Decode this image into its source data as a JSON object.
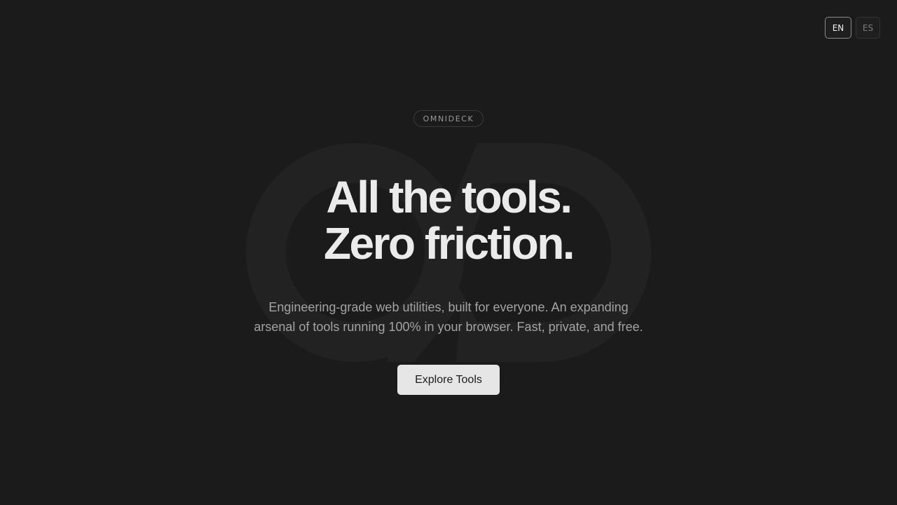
{
  "language_switch": {
    "options": [
      {
        "label": "EN",
        "active": true
      },
      {
        "label": "ES",
        "active": false
      }
    ]
  },
  "hero": {
    "brand_pill": "OMNIDECK",
    "headline_line1": "All the tools.",
    "headline_line2": "Zero friction.",
    "subtitle_line1": "Engineering-grade web utilities, built for everyone. An expanding",
    "subtitle_line2": "arsenal of tools running 100% in your browser. Fast, private, and free.",
    "cta_label": "Explore Tools"
  },
  "background_logo": "omnideck-logo-watermark",
  "colors": {
    "background": "#1b1b1b",
    "headline": "#ebebeb",
    "subtitle": "#a3a3a3",
    "cta_bg": "#e6e6e6",
    "watermark": "#222222"
  }
}
